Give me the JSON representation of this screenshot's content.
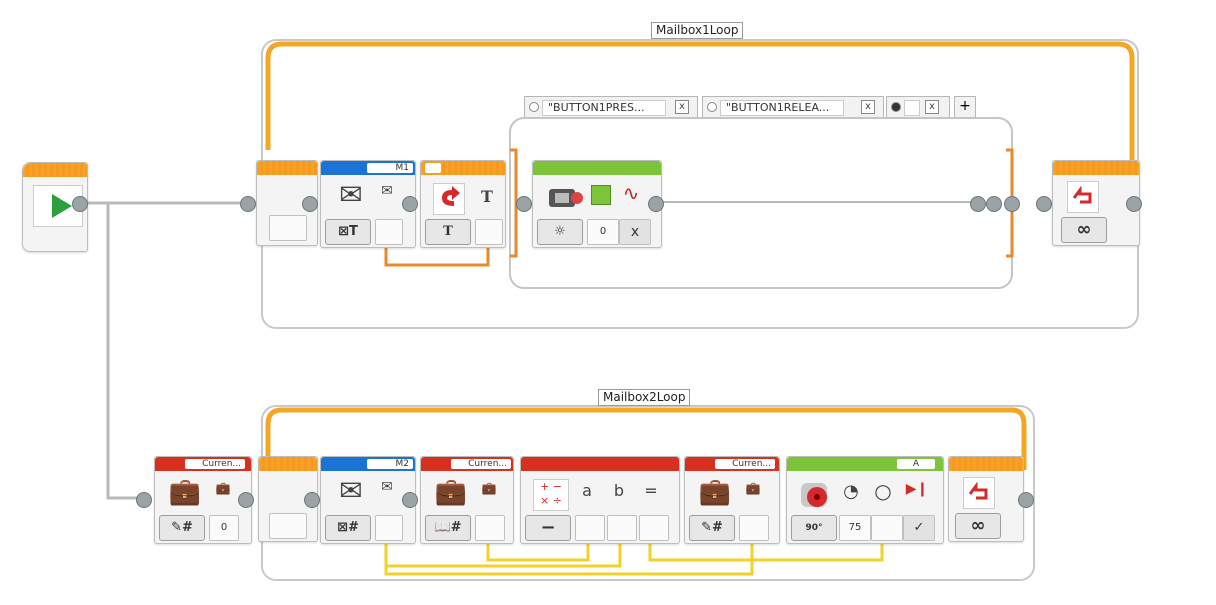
{
  "loops": {
    "loop1_label": "Mailbox1Loop",
    "loop2_label": "Mailbox2Loop",
    "loop1_mode": "∞",
    "loop2_mode": "∞"
  },
  "start_block": {
    "icon": "play-icon"
  },
  "loop1": {
    "mailbox": {
      "name": "M1",
      "mode_icon": "mailbox-receive-text-icon",
      "mode_text": "T",
      "out_icon": "envelope-icon"
    },
    "switch": {
      "mode_text": "T",
      "input_label": "T",
      "cases": [
        {
          "label": "\"BUTTON1PRES...",
          "icon": "delete-case-icon",
          "close": "x"
        },
        {
          "label": "\"BUTTON1RELEA...",
          "icon": "delete-case-icon",
          "close": "x"
        },
        {
          "label": "",
          "icon": "default-case-icon",
          "close": "x"
        }
      ],
      "add_case": "+"
    },
    "brick_light": {
      "color_value": "0",
      "pulse_icon": "pulse-icon",
      "mode_icon": "brick-light-icon",
      "off_icon": "x"
    }
  },
  "loop2": {
    "variable_read": {
      "name": "Curren...",
      "value": "0",
      "mode_icon": "write-numeric-icon",
      "mode_text": "#"
    },
    "mailbox": {
      "name": "M2",
      "mode_text": "#",
      "out_icon": "envelope-icon"
    },
    "variable_mid": {
      "name": "Curren...",
      "mode_text": "#"
    },
    "math": {
      "op_symbols": "+ − × ÷",
      "a": "a",
      "b": "b",
      "eq": "=",
      "mode_icon": "minus-icon"
    },
    "variable_write": {
      "name": "Curren...",
      "mode_text": "#"
    },
    "motor": {
      "port": "A",
      "power": "75",
      "degrees_label": "90°",
      "brake_icon": "check-icon"
    }
  },
  "colors": {
    "flow_orange": "#f5a623",
    "mailbox_blue": "#1c73d6",
    "data_red": "#d8301f",
    "action_green": "#7ec43a",
    "wire_yellow": "#f2d22a",
    "wire_orange": "#e88a2a"
  }
}
